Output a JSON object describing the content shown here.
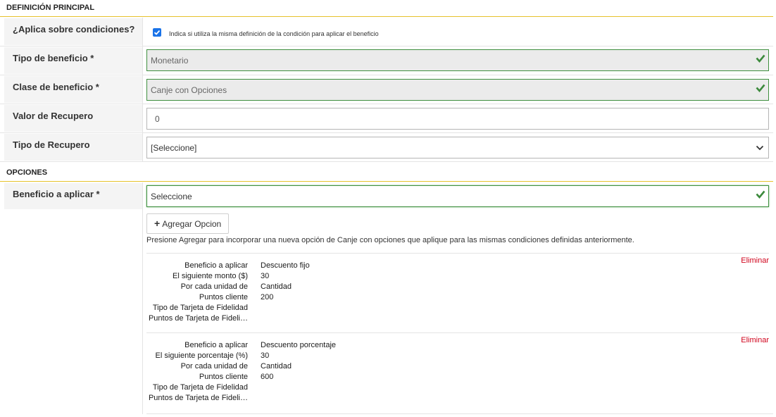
{
  "sections": {
    "main_title": "DEFINICIÓN PRINCIPAL",
    "options_title": "OPCIONES"
  },
  "fields": {
    "aplica": {
      "label": "¿Aplica sobre condiciones?",
      "checked": true,
      "hint": "Indica si utiliza la misma definición de la condición para aplicar el beneficio"
    },
    "tipo_beneficio": {
      "label": "Tipo de beneficio *",
      "value": "Monetario"
    },
    "clase_beneficio": {
      "label": "Clase de beneficio *",
      "value": "Canje con Opciones"
    },
    "valor_recupero": {
      "label": "Valor de Recupero",
      "value": "0"
    },
    "tipo_recupero": {
      "label": "Tipo de Recupero",
      "value": "[Seleccione]"
    },
    "beneficio_aplicar": {
      "label": "Beneficio a aplicar *",
      "value": "Seleccione"
    }
  },
  "add_option": {
    "label": "Agregar Opcion",
    "help": "Presione Agregar para incorporar una nueva opción de Canje con opciones que aplique para las mismas condiciones definidas anteriormente."
  },
  "options": [
    {
      "delete_label": "Eliminar",
      "rows": [
        {
          "key": "Beneficio a aplicar",
          "value": "Descuento fijo"
        },
        {
          "key": "El siguiente monto ($)",
          "value": "30"
        },
        {
          "key": "Por cada unidad de",
          "value": "Cantidad"
        },
        {
          "key": "Puntos cliente",
          "value": "200"
        },
        {
          "key": "Tipo de Tarjeta de Fidelidad",
          "value": ""
        },
        {
          "key": "Puntos de Tarjeta de Fideli…",
          "value": ""
        }
      ]
    },
    {
      "delete_label": "Eliminar",
      "rows": [
        {
          "key": "Beneficio a aplicar",
          "value": "Descuento porcentaje"
        },
        {
          "key": "El siguiente porcentaje (%)",
          "value": "30"
        },
        {
          "key": "Por cada unidad de",
          "value": "Cantidad"
        },
        {
          "key": "Puntos cliente",
          "value": "600"
        },
        {
          "key": "Tipo de Tarjeta de Fidelidad",
          "value": ""
        },
        {
          "key": "Puntos de Tarjeta de Fideli…",
          "value": ""
        }
      ]
    }
  ],
  "icons": {
    "valid": "check-icon",
    "dropdown": "chevron-down-icon",
    "add": "plus-icon",
    "checkbox": "checkbox-checked-icon"
  },
  "colors": {
    "section_underline": "#e6c22c",
    "valid_border": "#3f8f3f",
    "check_green": "#3c8a3c",
    "checkbox_blue": "#1a73e8",
    "delete_red": "#d0021b"
  }
}
